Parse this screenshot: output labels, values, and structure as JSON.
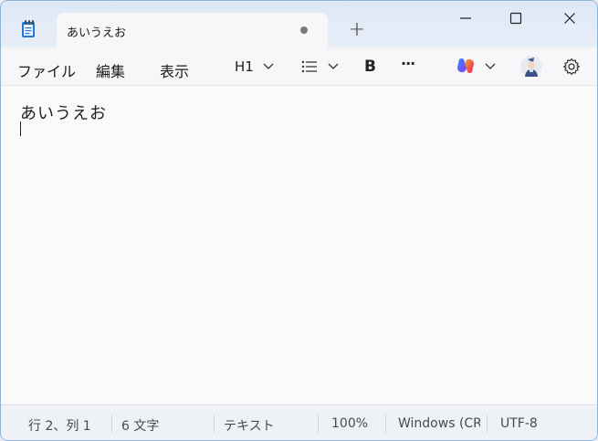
{
  "window": {
    "tab_title": "あいうえお",
    "new_tab_symbol": "+"
  },
  "menu": {
    "file": "ファイル",
    "edit": "編集",
    "view": "表示"
  },
  "toolbar": {
    "heading": "H1",
    "bold": "B",
    "more": "···"
  },
  "editor": {
    "text": "あいうえお"
  },
  "status": {
    "position": "行 2、列 1",
    "char_count": "6 文字",
    "format": "テキスト",
    "zoom": "100%",
    "line_ending": "Windows (CR",
    "encoding": "UTF-8"
  },
  "colors": {
    "accent": "#8fb3d9",
    "tab_bg": "#f7f7f9",
    "editor_bg": "#fafafa"
  },
  "icons": {
    "app": "notepad-icon",
    "list": "bulleted-list-icon",
    "copilot": "copilot-icon",
    "avatar": "user-avatar-icon",
    "settings": "gear-icon"
  }
}
